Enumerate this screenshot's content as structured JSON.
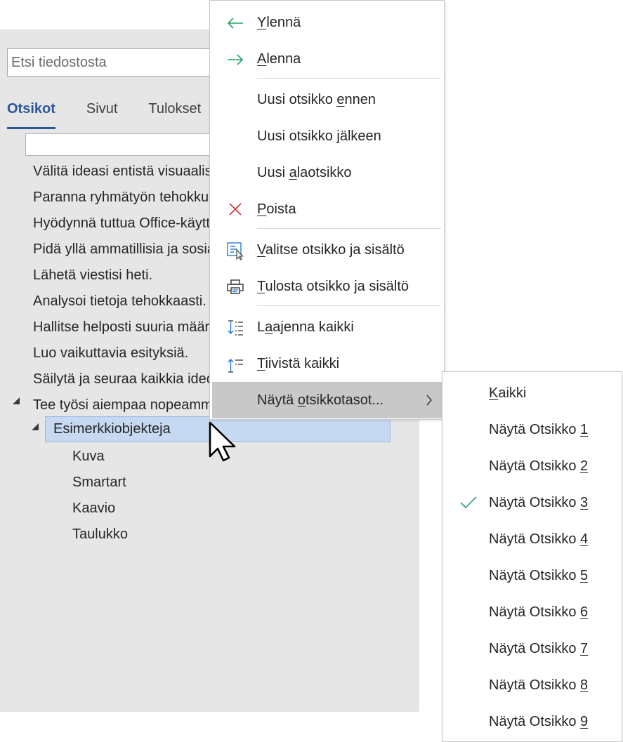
{
  "nav_pane": {
    "search_placeholder": "Etsi tiedostosta",
    "tabs": [
      {
        "label": "Otsikot",
        "active": true
      },
      {
        "label": "Sivut",
        "active": false
      },
      {
        "label": "Tulokset",
        "active": false
      }
    ],
    "headings": [
      {
        "text": "Välitä ideasi entistä visuaalisemmin.",
        "level": 1
      },
      {
        "text": "Paranna ryhmätyön tehokkuutta.",
        "level": 1
      },
      {
        "text": "Hyödynnä tuttua Office-käyttökokemusta.",
        "level": 1
      },
      {
        "text": "Pidä yllä ammatillisia ja sosiaalisia yhteyksiä.",
        "level": 1
      },
      {
        "text": "Lähetä viestisi heti.",
        "level": 1
      },
      {
        "text": "Analysoi tietoja tehokkaasti.",
        "level": 1
      },
      {
        "text": "Hallitse helposti suuria määriä tietoa.",
        "level": 1
      },
      {
        "text": "Luo vaikuttavia esityksiä.",
        "level": 1
      },
      {
        "text": "Säilytä ja seuraa kaikkia ideoitasi.",
        "level": 1
      },
      {
        "text": "Tee työsi aiempaa nopeammin.",
        "level": 1,
        "expanded": true
      },
      {
        "text": "Esimerkkiobjekteja",
        "level": 2,
        "expanded": true,
        "selected": true
      },
      {
        "text": "Kuva",
        "level": 3
      },
      {
        "text": "Smartart",
        "level": 3
      },
      {
        "text": "Kaavio",
        "level": 3
      },
      {
        "text": "Taulukko",
        "level": 3
      }
    ]
  },
  "context_menu": {
    "promote": {
      "pre": "",
      "key": "Y",
      "post": "lennä",
      "icon": "arrow-left-icon"
    },
    "demote": {
      "pre": "",
      "key": "A",
      "post": "lenna",
      "icon": "arrow-right-icon"
    },
    "new_before": {
      "pre": "Uusi otsikko ",
      "key": "e",
      "post": "nnen"
    },
    "new_after": {
      "pre": "Uusi otsikko ",
      "key": "j",
      "post": "älkeen"
    },
    "new_sub": {
      "pre": "Uusi ",
      "key": "a",
      "post": "laotsikko"
    },
    "delete": {
      "pre": "",
      "key": "P",
      "post": "oista",
      "icon": "close-icon"
    },
    "select_content": {
      "pre": "",
      "key": "V",
      "post": "alitse otsikko ja sisältö",
      "icon": "select-content-icon"
    },
    "print_content": {
      "pre": "",
      "key": "T",
      "post": "ulosta otsikko ja sisältö",
      "icon": "printer-icon"
    },
    "expand_all": {
      "pre": "L",
      "key": "a",
      "post": "ajenna kaikki",
      "icon": "expand-all-icon"
    },
    "collapse_all": {
      "pre": "",
      "key": "T",
      "post": "iivistä kaikki",
      "icon": "collapse-all-icon"
    },
    "show_levels": {
      "pre": "Näytä ",
      "key": "o",
      "post": "tsikkotasot..."
    }
  },
  "submenu": {
    "all": {
      "pre": "",
      "key": "K",
      "post": "aikki"
    },
    "level_prefix": "Näytä Otsikko ",
    "levels": [
      "1",
      "2",
      "3",
      "4",
      "5",
      "6",
      "7",
      "8",
      "9"
    ],
    "checked_level": "3"
  },
  "colors": {
    "accent": "#2b579a",
    "arrow_icon": "#21a366",
    "delete_icon": "#d13438",
    "ribbon_icon": "#2b7cd3",
    "check": "#3aa874",
    "selection": "#c6d9f1"
  }
}
